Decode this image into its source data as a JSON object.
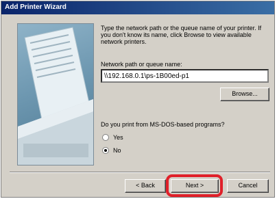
{
  "window": {
    "title": "Add Printer Wizard"
  },
  "description": "Type the network path or the queue name of your printer. If you don't know its name, click Browse to view available network printers.",
  "path_field": {
    "label": "Network path or queue name:",
    "value": "\\\\192.168.0.1\\ps-1B00ed-p1"
  },
  "browse_label": "Browse...",
  "msdos_question": "Do you print from MS-DOS-based programs?",
  "options": [
    {
      "label": "Yes",
      "selected": false
    },
    {
      "label": "No",
      "selected": true
    }
  ],
  "footer": {
    "back_label": "< Back",
    "next_label": "Next >",
    "cancel_label": "Cancel"
  },
  "colors": {
    "highlight": "#e0202a",
    "title_start": "#0a246a",
    "title_end": "#3a6ea5"
  }
}
